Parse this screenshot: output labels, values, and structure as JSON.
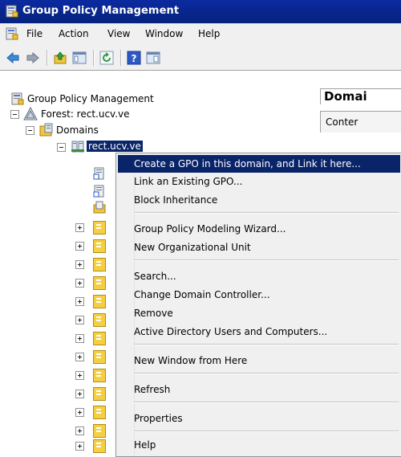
{
  "window": {
    "title": "Group Policy Management"
  },
  "menubar": {
    "items": [
      "File",
      "Action",
      "View",
      "Window",
      "Help"
    ]
  },
  "toolbar": {
    "icons": [
      "back-arrow-icon",
      "forward-arrow-icon",
      "up-folder-icon",
      "show-hide-tree-icon",
      "refresh-icon",
      "help-icon",
      "properties-pane-icon"
    ]
  },
  "tree": {
    "root": "Group Policy Management",
    "forest": "Forest: rect.ucv.ve",
    "domains": "Domains",
    "domain": "rect.ucv.ve"
  },
  "right_panel": {
    "title": "Domai",
    "tab": "Conter"
  },
  "context_menu": {
    "items": [
      "Create a GPO in this domain, and Link it here...",
      "Link an Existing GPO...",
      "Block Inheritance",
      "Group Policy Modeling Wizard...",
      "New Organizational Unit",
      "Search...",
      "Change Domain Controller...",
      "Remove",
      "Active Directory Users and Computers...",
      "New Window from Here",
      "Refresh",
      "Properties",
      "Help"
    ],
    "highlighted_index": 0
  },
  "colors": {
    "titlebar": "#0a246a",
    "selection": "#0a246a",
    "ou_folder": "#f5cf41"
  }
}
